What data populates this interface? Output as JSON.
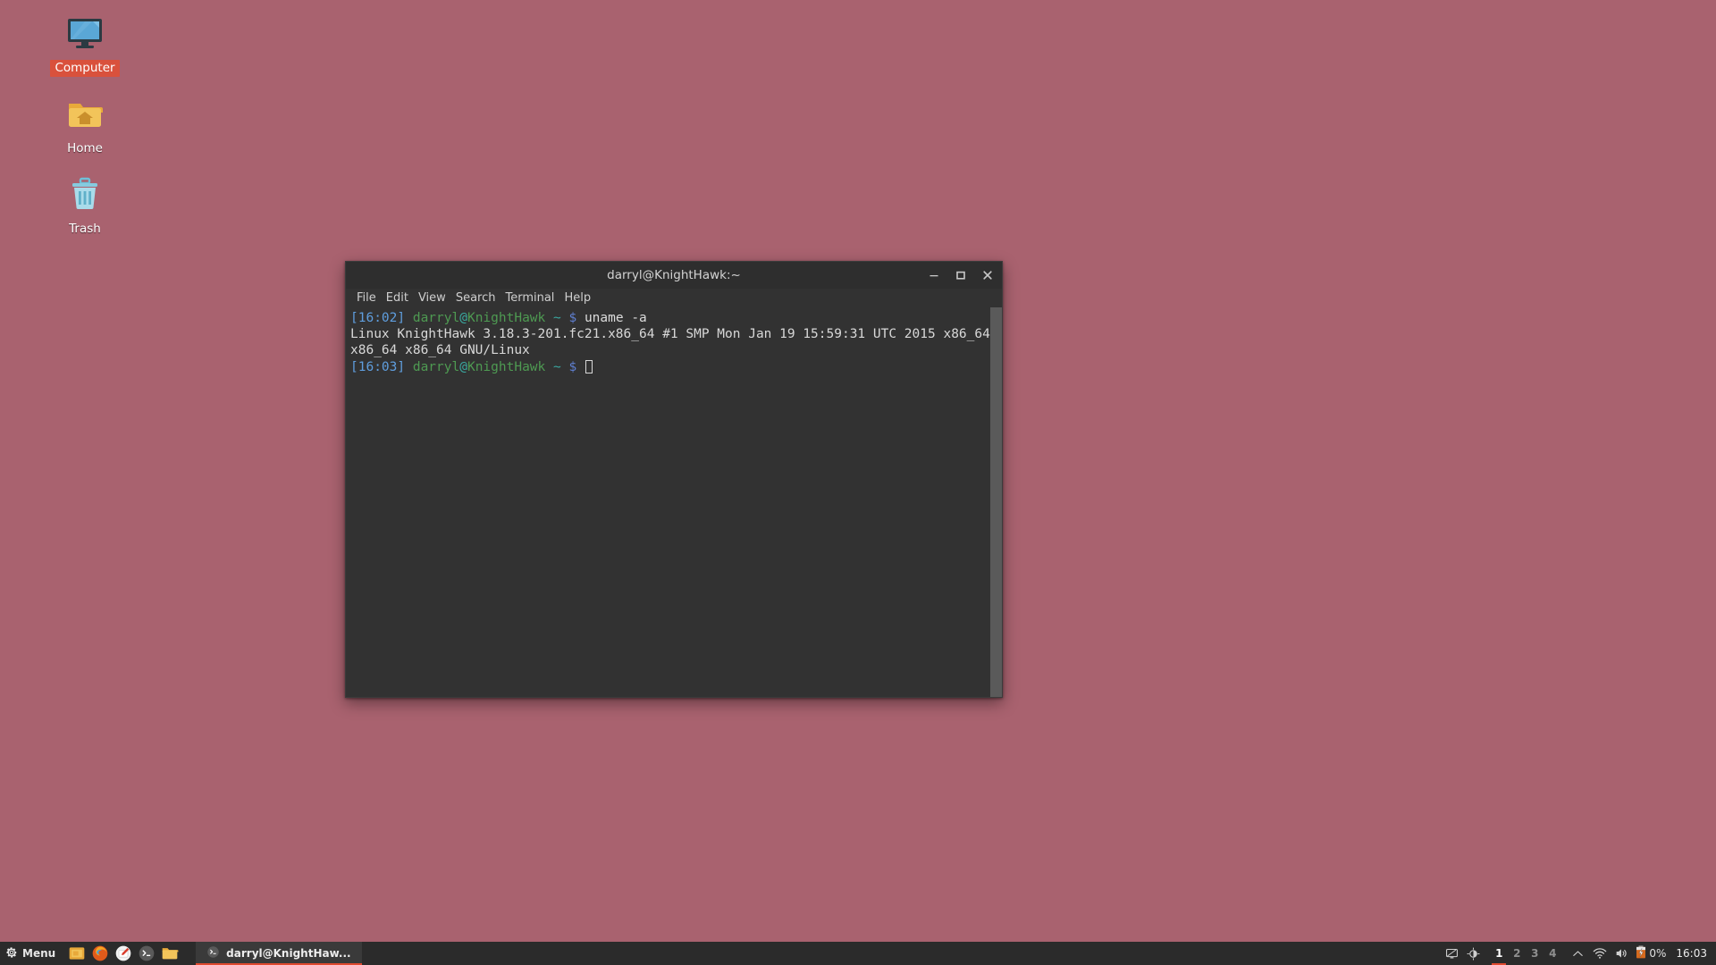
{
  "desktop": {
    "background_color": "#a9626f",
    "selection_color": "#d9513c",
    "icons": [
      {
        "label": "Computer",
        "icon": "computer-monitor-icon",
        "selected": true
      },
      {
        "label": "Home",
        "icon": "home-folder-icon",
        "selected": false
      },
      {
        "label": "Trash",
        "icon": "trash-can-icon",
        "selected": false
      }
    ]
  },
  "terminal_window": {
    "title": "darryl@KnightHawk:~",
    "background_color": "#323232",
    "titlebar_color": "#2e2e2e",
    "controls": [
      {
        "name": "minimize",
        "glyph": "–"
      },
      {
        "name": "maximize",
        "glyph": "□"
      },
      {
        "name": "close",
        "glyph": "✕"
      }
    ],
    "menu_items": [
      "File",
      "Edit",
      "View",
      "Search",
      "Terminal",
      "Help"
    ],
    "lines": [
      {
        "type": "prompt",
        "time": "[16:02]",
        "user": "darryl",
        "at": "@",
        "host": "KnightHawk",
        "path": "~",
        "symbol": "$",
        "command": "uname -a"
      },
      {
        "type": "output",
        "text": "Linux KnightHawk 3.18.3-201.fc21.x86_64 #1 SMP Mon Jan 19 15:59:31 UTC 2015 x86_64 x86_64 x86_64 GNU/Linux"
      },
      {
        "type": "prompt",
        "time": "[16:03]",
        "user": "darryl",
        "at": "@",
        "host": "KnightHawk",
        "path": "~",
        "symbol": "$",
        "command": ""
      }
    ],
    "colors": {
      "time": "#5f9ede",
      "user": "#4e9a52",
      "at": "#3aa8a0",
      "host": "#4e9a52",
      "path": "#3aa8a0",
      "dollar": "#5f7fd0",
      "text": "#d8d8d8"
    }
  },
  "taskbar": {
    "menu_label": "Menu",
    "launchers": [
      {
        "name": "file-manager-launcher",
        "title": "File Manager"
      },
      {
        "name": "firefox-launcher",
        "title": "Firefox"
      },
      {
        "name": "text-editor-launcher",
        "title": "Text Editor"
      },
      {
        "name": "terminal-launcher",
        "title": "Terminal"
      },
      {
        "name": "folder-launcher",
        "title": "Home Folder"
      }
    ],
    "tasks": [
      {
        "label": "darryl@KnightHaw...",
        "active": true,
        "icon": "terminal-icon"
      }
    ],
    "workspaces": [
      {
        "label": "1",
        "active": true
      },
      {
        "label": "2",
        "active": false
      },
      {
        "label": "3",
        "active": false
      },
      {
        "label": "4",
        "active": false
      }
    ],
    "tray": {
      "display_icon": "display-icon",
      "brightness_icon": "brightness-icon",
      "show_hidden_icon": "chevron-up-icon",
      "network_icon": "wifi-icon",
      "volume_icon": "volume-icon",
      "battery_icon": "battery-charging-icon",
      "battery_percent": "0%",
      "clock": "16:03"
    },
    "accent_color": "#e04a2f",
    "background_color": "#2b2b2b"
  }
}
